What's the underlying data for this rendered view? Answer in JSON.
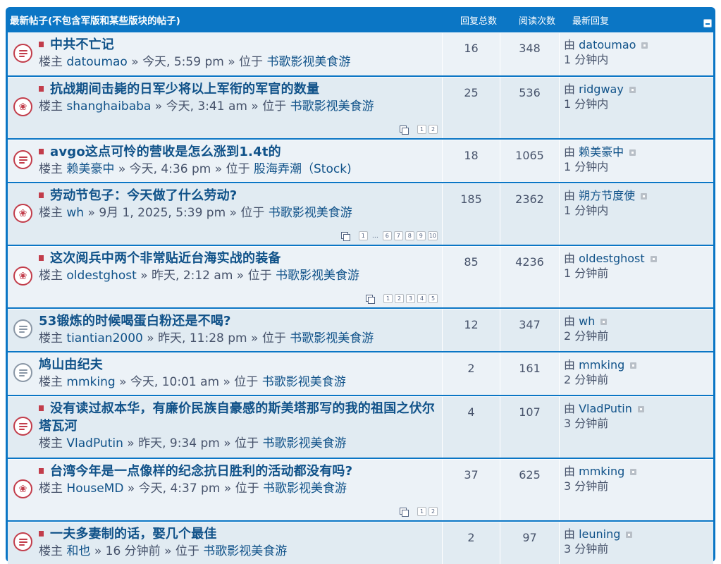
{
  "header": {
    "title": "最新帖子(不包含军版和某些版块的帖子)",
    "replies": "回复总数",
    "views": "阅读次数",
    "last": "最新回复"
  },
  "labels": {
    "author_prefix": "楼主",
    "sep": "»",
    "in_forum": "位于",
    "by": "由"
  },
  "topics": [
    {
      "title": "中共不亡记",
      "author": "datoumao",
      "time": "今天, 5:59 pm",
      "forum": "书歌影视美食游",
      "replies": "16",
      "views": "348",
      "last_user": "datoumao",
      "last_time": "1 分钟内",
      "icon": "unread",
      "new": true,
      "pages": []
    },
    {
      "title": "抗战期间击毙的日军少将以上军衔的军官的数量",
      "author": "shanghaibaba",
      "time": "今天, 3:41 am",
      "forum": "书歌影视美食游",
      "replies": "25",
      "views": "536",
      "last_user": "ridgway",
      "last_time": "1 分钟内",
      "icon": "hot",
      "new": true,
      "pages": [
        "1",
        "2"
      ]
    },
    {
      "title": "avgo这点可怜的营收是怎么涨到1.4t的",
      "author": "赖美豪中",
      "time": "今天, 4:36 pm",
      "forum": "股海弄潮（Stock)",
      "replies": "18",
      "views": "1065",
      "last_user": "赖美豪中",
      "last_time": "1 分钟内",
      "icon": "unread",
      "new": true,
      "pages": []
    },
    {
      "title": "劳动节包子：今天做了什么劳动?",
      "author": "wh",
      "time": "9月 1, 2025, 5:39 pm",
      "forum": "书歌影视美食游",
      "replies": "185",
      "views": "2362",
      "last_user": "朔方节度使",
      "last_time": "1 分钟内",
      "icon": "hot",
      "new": true,
      "pages": [
        "1",
        "…",
        "6",
        "7",
        "8",
        "9",
        "10"
      ]
    },
    {
      "title": "这次阅兵中两个非常贴近台海实战的装备",
      "author": "oldestghost",
      "time": "昨天, 2:12 am",
      "forum": "书歌影视美食游",
      "replies": "85",
      "views": "4236",
      "last_user": "oldestghost",
      "last_time": "1 分钟前",
      "icon": "hot",
      "new": true,
      "pages": [
        "1",
        "2",
        "3",
        "4",
        "5"
      ]
    },
    {
      "title": "53锻炼的时候喝蛋白粉还是不喝?",
      "author": "tiantian2000",
      "time": "昨天, 11:28 pm",
      "forum": "书歌影视美食游",
      "replies": "12",
      "views": "347",
      "last_user": "wh",
      "last_time": "2 分钟前",
      "icon": "read",
      "new": false,
      "pages": []
    },
    {
      "title": "鸠山由纪夫",
      "author": "mmking",
      "time": "今天, 10:01 am",
      "forum": "书歌影视美食游",
      "replies": "2",
      "views": "161",
      "last_user": "mmking",
      "last_time": "2 分钟前",
      "icon": "read",
      "new": false,
      "pages": []
    },
    {
      "title": "没有读过叔本华，有廉价民族自豪感的斯美塔那写的我的祖国之伏尔塔瓦河",
      "author": "VladPutin",
      "time": "昨天, 9:34 pm",
      "forum": "书歌影视美食游",
      "replies": "4",
      "views": "107",
      "last_user": "VladPutin",
      "last_time": "3 分钟前",
      "icon": "unread",
      "new": true,
      "pages": []
    },
    {
      "title": "台湾今年是一点像样的纪念抗日胜利的活动都没有吗?",
      "author": "HouseMD",
      "time": "今天, 4:37 pm",
      "forum": "书歌影视美食游",
      "replies": "37",
      "views": "625",
      "last_user": "mmking",
      "last_time": "3 分钟前",
      "icon": "hot",
      "new": true,
      "pages": [
        "1",
        "2"
      ]
    },
    {
      "title": "一夫多妻制的话，娶几个最佳",
      "author": "和也",
      "time": "16 分钟前",
      "forum": "书歌影视美食游",
      "replies": "2",
      "views": "97",
      "last_user": "leuning",
      "last_time": "3 分钟前",
      "icon": "unread",
      "new": true,
      "pages": []
    }
  ]
}
